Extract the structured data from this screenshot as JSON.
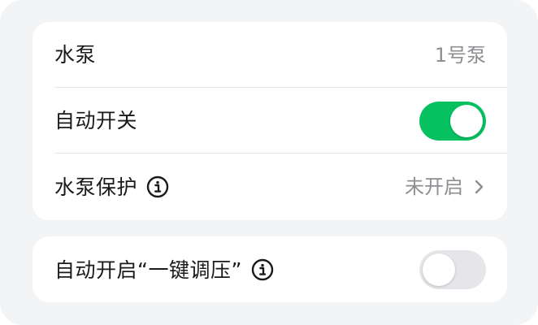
{
  "settings": {
    "pump": {
      "label": "水泵",
      "value": "1号泵"
    },
    "auto_switch": {
      "label": "自动开关",
      "enabled": true
    },
    "pump_protection": {
      "label": "水泵保护",
      "value": "未开启"
    },
    "auto_pressure": {
      "label": "自动开启“一键调压”",
      "enabled": false
    }
  },
  "icons": {
    "info": "info-icon",
    "chevron": "chevron-right-icon"
  },
  "colors": {
    "toggle_on": "#07c160",
    "toggle_off": "#e5e5ea",
    "background": "#f3f4f6",
    "card": "#ffffff",
    "secondary_text": "#8e8e93"
  }
}
